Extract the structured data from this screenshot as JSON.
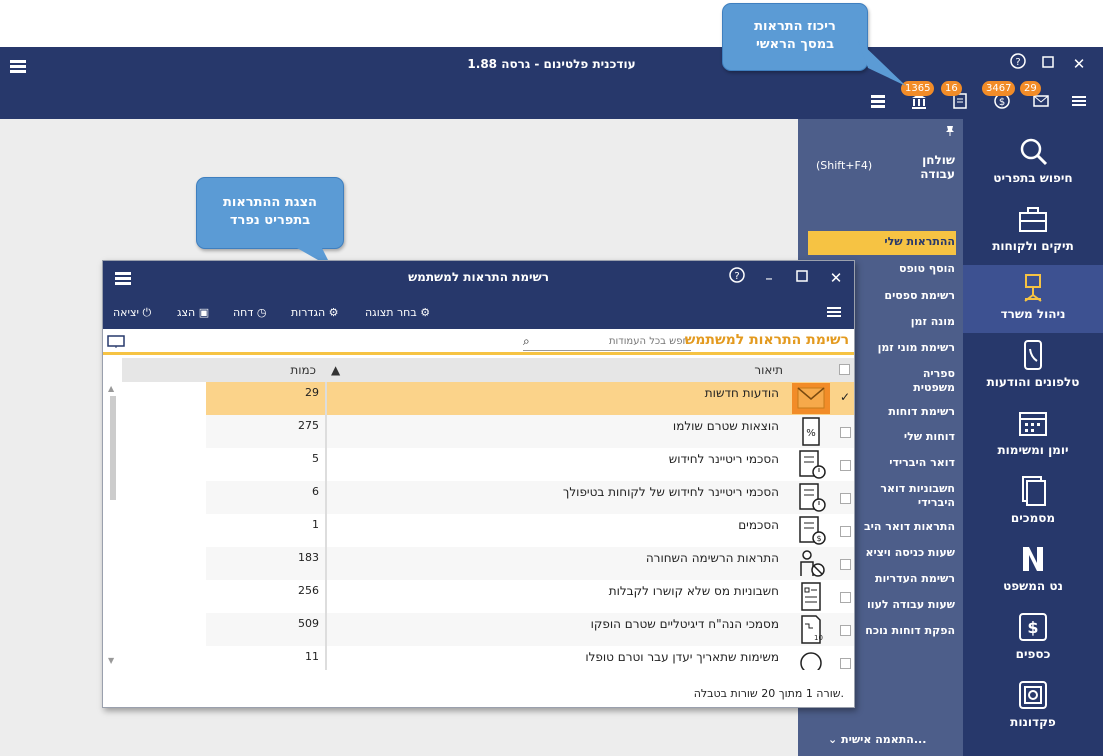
{
  "callouts": {
    "top": "ריכוז התראות\nבמסך הראשי",
    "left": "הצגת ההתראות\nבתפריט נפרד"
  },
  "window": {
    "title": "עודכנית פלטינום - גרסה 1.88",
    "badges": {
      "mail": "29",
      "money": "3467",
      "doc": "16",
      "bank": "1365"
    }
  },
  "nav": {
    "items": [
      {
        "label": "חיפוש בתפריט"
      },
      {
        "label": "תיקים ולקוחות"
      },
      {
        "label": "ניהול משרד"
      },
      {
        "label": "טלפונים והודעות"
      },
      {
        "label": "יומן ומשימות"
      },
      {
        "label": "מסמכים"
      },
      {
        "label": "נט המשפט"
      },
      {
        "label": "כספים"
      },
      {
        "label": "פקדונות"
      }
    ]
  },
  "submenu": {
    "workdesk": "שולחן\nעבודה",
    "shortcut": "(Shift+F4)",
    "items": [
      "ההתראות שלי",
      "הוסף טופס",
      "רשימת ספסים",
      "מונה זמן",
      "רשימת מוני זמן",
      "ספריה\nמשפטית",
      "רשימת דוחות",
      "דוחות שלי",
      "דואר היברידי",
      "חשבוניות דואר\nהיברידי",
      "התראות דואר היב",
      "שעות כניסה ויציא",
      "רשימת העדריות",
      "שעות עבודה לעוו",
      "הפקת דוחות נוכח"
    ],
    "customize": "התאמה אישית..."
  },
  "dialog": {
    "title": "רשימת התראות למשתמש",
    "toolbar": {
      "exit": "יציאה",
      "show": "הצג",
      "postpone": "דחה",
      "settings": "הגדרות",
      "display": "בחר תצוגה"
    },
    "header_title": "רשימת התראות למשתמש",
    "search_placeholder": "חפש בכל העמודות",
    "columns": {
      "desc": "תיאור",
      "qty": "כמות"
    },
    "rows": [
      {
        "desc": "הודעות חדשות",
        "qty": "29",
        "icon": "envelope-icon",
        "checked": true
      },
      {
        "desc": "הוצאות שטרם שולמו",
        "qty": "275",
        "icon": "percent-doc-icon",
        "checked": false
      },
      {
        "desc": "הסכמי ריטיינר לחידוש",
        "qty": "5",
        "icon": "doc-clock-icon",
        "checked": false
      },
      {
        "desc": "הסכמי ריטיינר לחידוש של לקוחות בטיפולך",
        "qty": "6",
        "icon": "doc-clock-icon",
        "checked": false
      },
      {
        "desc": "הסכמים",
        "qty": "1",
        "icon": "doc-dollar-icon",
        "checked": false
      },
      {
        "desc": "התראות הרשימה השחורה",
        "qty": "183",
        "icon": "person-block-icon",
        "checked": false
      },
      {
        "desc": "חשבוניות מס שלא קושרו לקבלות",
        "qty": "256",
        "icon": "invoice-icon",
        "checked": false
      },
      {
        "desc": "מסמכי הנה\"ח דיגיטליים שטרם הופקו",
        "qty": "509",
        "icon": "digital-doc-icon",
        "checked": false
      },
      {
        "desc": "משימות שתאריך יעדן עבר וטרם טופלו",
        "qty": "11",
        "icon": "bulb-icon",
        "checked": false
      }
    ],
    "status": "שורה 1 מתוך 20 שורות בטבלה."
  },
  "colors": {
    "navy": "#27386b",
    "accent": "#f6c343",
    "highlight": "#fbd38a",
    "badge": "#f28c28"
  }
}
